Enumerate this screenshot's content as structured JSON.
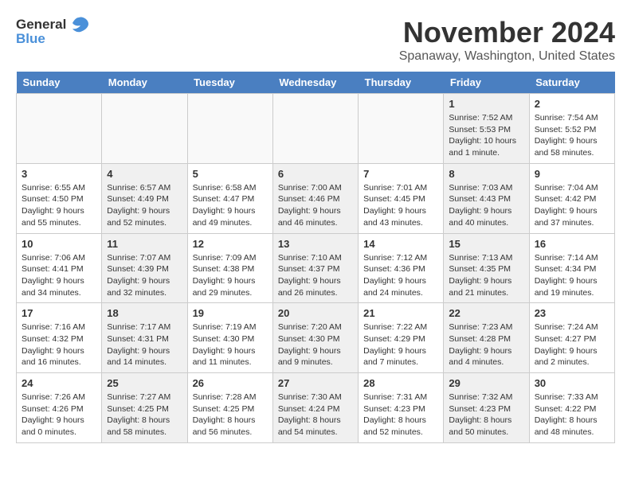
{
  "logo": {
    "general": "General",
    "blue": "Blue"
  },
  "title": "November 2024",
  "location": "Spanaway, Washington, United States",
  "days_of_week": [
    "Sunday",
    "Monday",
    "Tuesday",
    "Wednesday",
    "Thursday",
    "Friday",
    "Saturday"
  ],
  "weeks": [
    [
      {
        "day": "",
        "info": "",
        "empty": true
      },
      {
        "day": "",
        "info": "",
        "empty": true
      },
      {
        "day": "",
        "info": "",
        "empty": true
      },
      {
        "day": "",
        "info": "",
        "empty": true
      },
      {
        "day": "",
        "info": "",
        "empty": true
      },
      {
        "day": "1",
        "info": "Sunrise: 7:52 AM\nSunset: 5:53 PM\nDaylight: 10 hours and 1 minute."
      },
      {
        "day": "2",
        "info": "Sunrise: 7:54 AM\nSunset: 5:52 PM\nDaylight: 9 hours and 58 minutes."
      }
    ],
    [
      {
        "day": "3",
        "info": "Sunrise: 6:55 AM\nSunset: 4:50 PM\nDaylight: 9 hours and 55 minutes."
      },
      {
        "day": "4",
        "info": "Sunrise: 6:57 AM\nSunset: 4:49 PM\nDaylight: 9 hours and 52 minutes."
      },
      {
        "day": "5",
        "info": "Sunrise: 6:58 AM\nSunset: 4:47 PM\nDaylight: 9 hours and 49 minutes."
      },
      {
        "day": "6",
        "info": "Sunrise: 7:00 AM\nSunset: 4:46 PM\nDaylight: 9 hours and 46 minutes."
      },
      {
        "day": "7",
        "info": "Sunrise: 7:01 AM\nSunset: 4:45 PM\nDaylight: 9 hours and 43 minutes."
      },
      {
        "day": "8",
        "info": "Sunrise: 7:03 AM\nSunset: 4:43 PM\nDaylight: 9 hours and 40 minutes."
      },
      {
        "day": "9",
        "info": "Sunrise: 7:04 AM\nSunset: 4:42 PM\nDaylight: 9 hours and 37 minutes."
      }
    ],
    [
      {
        "day": "10",
        "info": "Sunrise: 7:06 AM\nSunset: 4:41 PM\nDaylight: 9 hours and 34 minutes."
      },
      {
        "day": "11",
        "info": "Sunrise: 7:07 AM\nSunset: 4:39 PM\nDaylight: 9 hours and 32 minutes."
      },
      {
        "day": "12",
        "info": "Sunrise: 7:09 AM\nSunset: 4:38 PM\nDaylight: 9 hours and 29 minutes."
      },
      {
        "day": "13",
        "info": "Sunrise: 7:10 AM\nSunset: 4:37 PM\nDaylight: 9 hours and 26 minutes."
      },
      {
        "day": "14",
        "info": "Sunrise: 7:12 AM\nSunset: 4:36 PM\nDaylight: 9 hours and 24 minutes."
      },
      {
        "day": "15",
        "info": "Sunrise: 7:13 AM\nSunset: 4:35 PM\nDaylight: 9 hours and 21 minutes."
      },
      {
        "day": "16",
        "info": "Sunrise: 7:14 AM\nSunset: 4:34 PM\nDaylight: 9 hours and 19 minutes."
      }
    ],
    [
      {
        "day": "17",
        "info": "Sunrise: 7:16 AM\nSunset: 4:32 PM\nDaylight: 9 hours and 16 minutes."
      },
      {
        "day": "18",
        "info": "Sunrise: 7:17 AM\nSunset: 4:31 PM\nDaylight: 9 hours and 14 minutes."
      },
      {
        "day": "19",
        "info": "Sunrise: 7:19 AM\nSunset: 4:30 PM\nDaylight: 9 hours and 11 minutes."
      },
      {
        "day": "20",
        "info": "Sunrise: 7:20 AM\nSunset: 4:30 PM\nDaylight: 9 hours and 9 minutes."
      },
      {
        "day": "21",
        "info": "Sunrise: 7:22 AM\nSunset: 4:29 PM\nDaylight: 9 hours and 7 minutes."
      },
      {
        "day": "22",
        "info": "Sunrise: 7:23 AM\nSunset: 4:28 PM\nDaylight: 9 hours and 4 minutes."
      },
      {
        "day": "23",
        "info": "Sunrise: 7:24 AM\nSunset: 4:27 PM\nDaylight: 9 hours and 2 minutes."
      }
    ],
    [
      {
        "day": "24",
        "info": "Sunrise: 7:26 AM\nSunset: 4:26 PM\nDaylight: 9 hours and 0 minutes."
      },
      {
        "day": "25",
        "info": "Sunrise: 7:27 AM\nSunset: 4:25 PM\nDaylight: 8 hours and 58 minutes."
      },
      {
        "day": "26",
        "info": "Sunrise: 7:28 AM\nSunset: 4:25 PM\nDaylight: 8 hours and 56 minutes."
      },
      {
        "day": "27",
        "info": "Sunrise: 7:30 AM\nSunset: 4:24 PM\nDaylight: 8 hours and 54 minutes."
      },
      {
        "day": "28",
        "info": "Sunrise: 7:31 AM\nSunset: 4:23 PM\nDaylight: 8 hours and 52 minutes."
      },
      {
        "day": "29",
        "info": "Sunrise: 7:32 AM\nSunset: 4:23 PM\nDaylight: 8 hours and 50 minutes."
      },
      {
        "day": "30",
        "info": "Sunrise: 7:33 AM\nSunset: 4:22 PM\nDaylight: 8 hours and 48 minutes."
      }
    ]
  ]
}
